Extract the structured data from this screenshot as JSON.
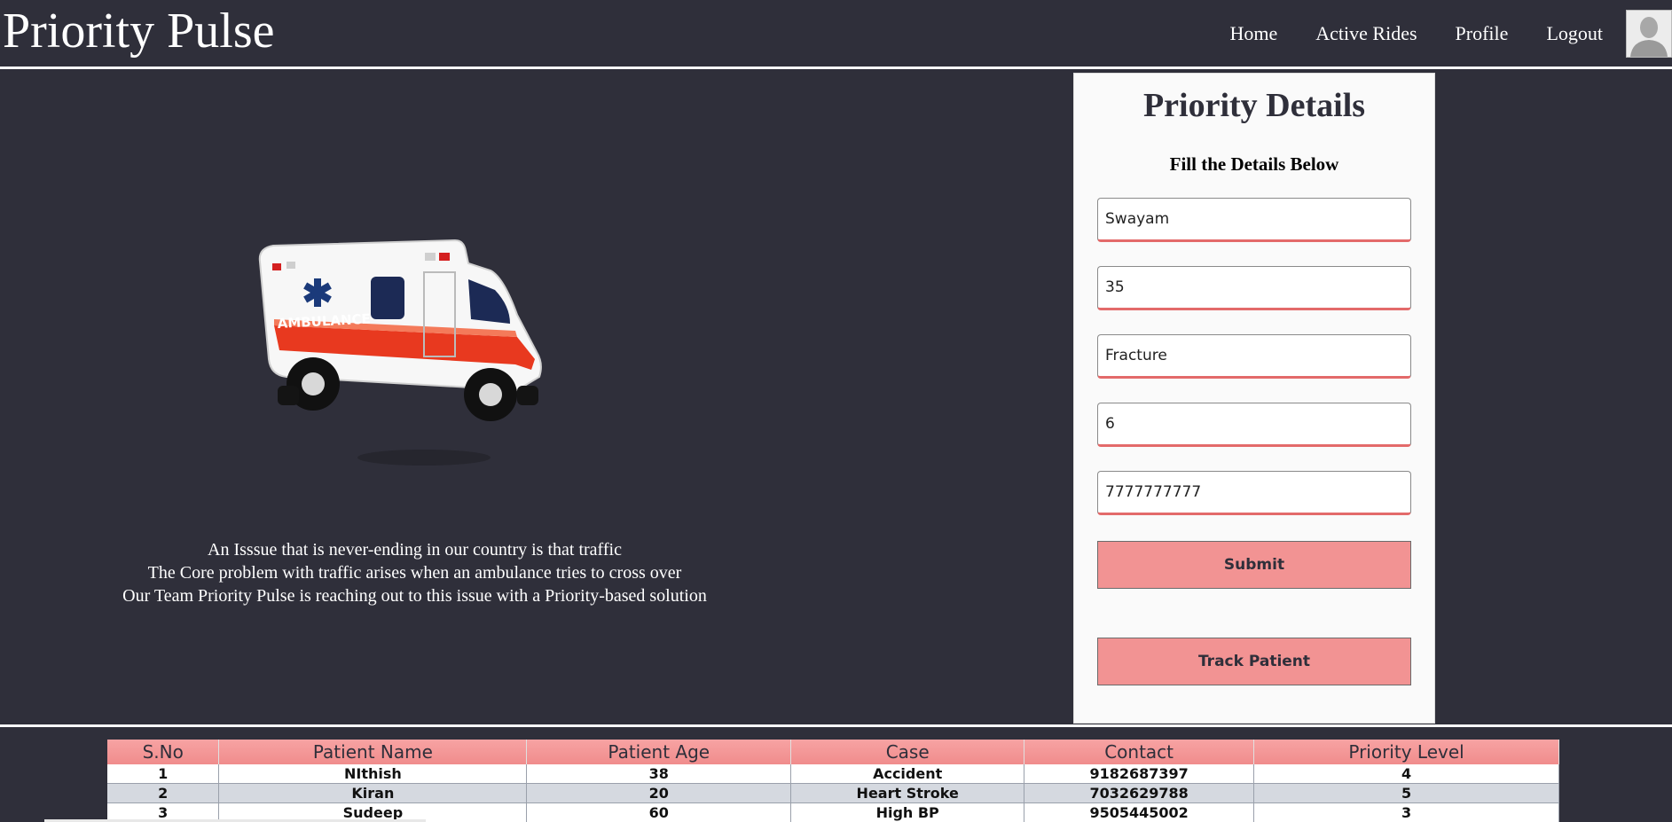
{
  "app": {
    "brand": "Priority Pulse"
  },
  "nav": {
    "links": [
      "Home",
      "Active Rides",
      "Profile",
      "Logout"
    ]
  },
  "hero": {
    "ambulance_text": "AMBULANCE",
    "lines": [
      "An Isssue that is never-ending in our country is that traffic",
      "The Core problem with traffic arises when an ambulance tries to cross over",
      "Our Team Priority Pulse is reaching out to this issue with a Priority-based solution"
    ]
  },
  "form": {
    "title": "Priority Details",
    "subtitle": "Fill the Details Below",
    "fields": [
      {
        "name": "patient-name",
        "value": "Swayam"
      },
      {
        "name": "patient-age",
        "value": "35"
      },
      {
        "name": "case",
        "value": "Fracture"
      },
      {
        "name": "priority-level",
        "value": "6"
      },
      {
        "name": "contact",
        "value": "7777777777"
      }
    ],
    "submit_label": "Submit",
    "track_label": "Track Patient"
  },
  "table": {
    "headers": [
      "S.No",
      "Patient Name",
      "Patient Age",
      "Case",
      "Contact",
      "Priority Level"
    ],
    "rows": [
      [
        "1",
        "NIthish",
        "38",
        "Accident",
        "9182687397",
        "4"
      ],
      [
        "2",
        "Kiran",
        "20",
        "Heart Stroke",
        "7032629788",
        "5"
      ],
      [
        "3",
        "Sudeep",
        "60",
        "High BP",
        "9505445002",
        "3"
      ]
    ]
  },
  "colors": {
    "background": "#2f2f3a",
    "accent": "#f29393",
    "field_underline": "#e36a6a"
  }
}
